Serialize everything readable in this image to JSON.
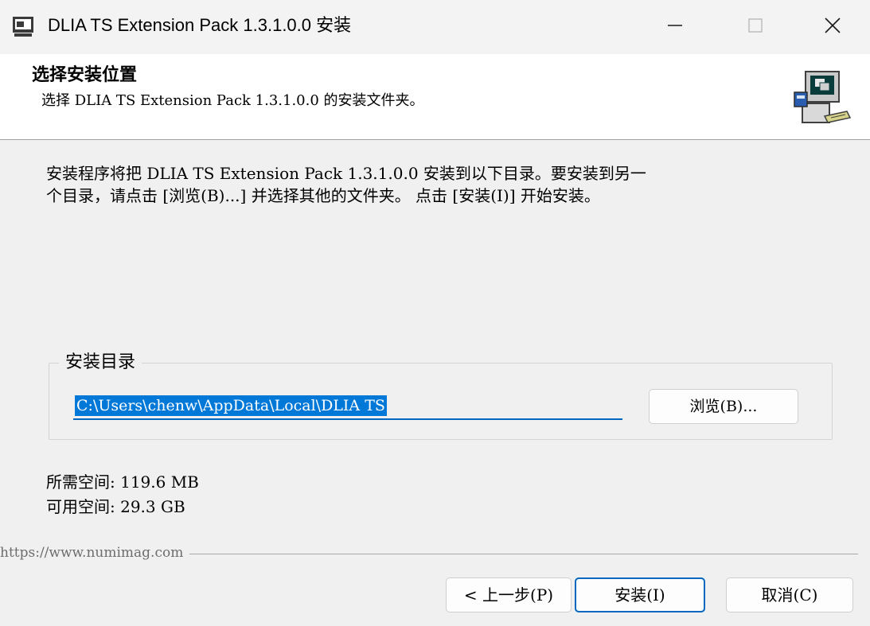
{
  "window": {
    "title": "DLIA TS Extension Pack 1.3.1.0.0 安装",
    "icons": [
      "installer-app-icon",
      "minimize-icon",
      "maximize-icon",
      "close-icon"
    ]
  },
  "header": {
    "title": "选择安装位置",
    "subtitle": "选择 DLIA TS Extension Pack 1.3.1.0.0 的安装文件夹。",
    "icon": "installer-computer-icon"
  },
  "body": {
    "instruction": "安装程序将把 DLIA TS Extension Pack 1.3.1.0.0 安装到以下目录。要安装到另一\n个目录，请点击 [浏览(B)...] 并选择其他的文件夹。 点击 [安装(I)] 开始安装。",
    "install_dir": {
      "group_label": "安装目录",
      "path_value": "C:\\Users\\chenw\\AppData\\Local\\DLIA TS",
      "browse_label": "浏览(B)..."
    },
    "space_required": "所需空间: 119.6 MB",
    "space_available": "可用空间: 29.3 GB"
  },
  "footer": {
    "branding": "https://www.numimag.com",
    "back_label": "< 上一步(P)",
    "install_label": "安装(I)",
    "cancel_label": "取消(C)"
  },
  "colors": {
    "accent": "#0067c0",
    "selection": "#0078d7",
    "window_bg": "#f0f0f0",
    "header_bg": "#ffffff"
  }
}
